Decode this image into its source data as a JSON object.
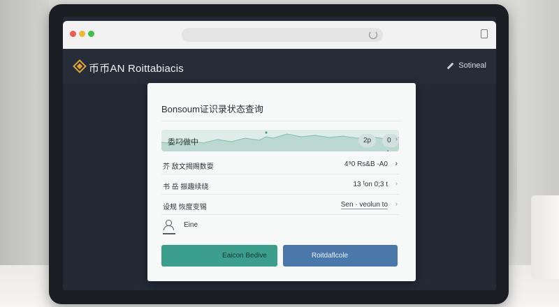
{
  "app": {
    "title": "币币AN Roittabiacis",
    "user_label": "Sotineal"
  },
  "card": {
    "title": "Bonsoum证识录状态查询",
    "sparkline": {
      "label": "委叼做中",
      "pill_1": "2p",
      "pill_2": "0 k"
    },
    "rows": [
      {
        "label": "芥 敌文揭赐数耍",
        "value": "4⁹0 Rs&B -A0"
      },
      {
        "label": "书 岳 振趣续绕",
        "value": "13 ᶠon 0;3 t"
      },
      {
        "label": "设规 恢度变锡",
        "value": "Sen · veolun to"
      }
    ],
    "user_name": "Eine",
    "primary_button": "Eaicon Bedive",
    "secondary_button": "Roitdaflcole"
  },
  "colors": {
    "accent_teal": "#3c9f8e",
    "accent_blue": "#4b78aa",
    "logo_gold": "#e0a534",
    "app_bg": "#232a36"
  }
}
